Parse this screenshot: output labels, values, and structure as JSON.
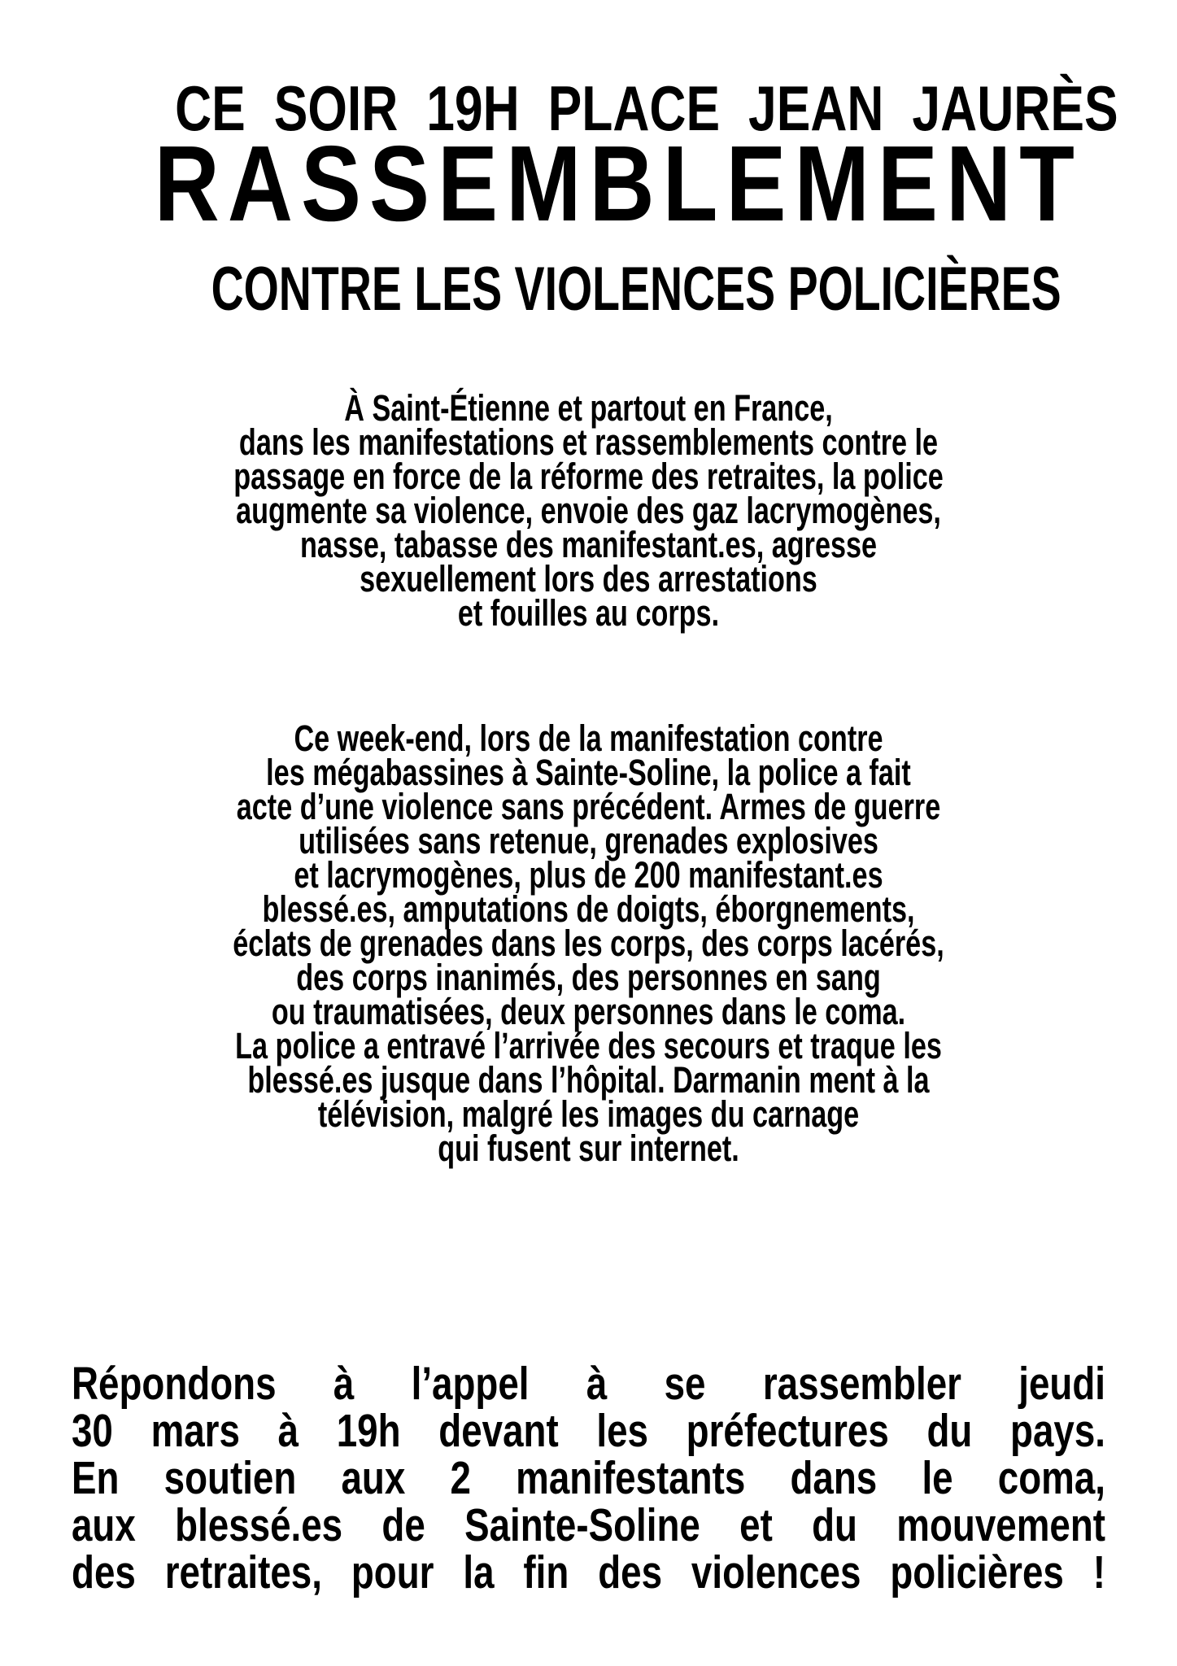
{
  "header": {
    "line1": "CE SOIR 19H PLACE JEAN JAURÈS",
    "line2": "RASSEMBLEMENT",
    "line3": "CONTRE LES VIOLENCES POLICIÈRES"
  },
  "paragraph1": [
    "À Saint-Étienne et partout en France,",
    "dans les manifestations et rassemblements contre le",
    "passage en force de la réforme des retraites, la police",
    "augmente sa violence, envoie des gaz lacrymogènes,",
    "nasse, tabasse des manifestant.es, agresse",
    "sexuellement lors des arrestations",
    "et fouilles au corps."
  ],
  "paragraph2": [
    "Ce week-end, lors de la manifestation contre",
    "les mégabassines à Sainte-Soline, la police a fait",
    "acte d’une violence sans précédent. Armes de guerre",
    "utilisées sans retenue, grenades explosives",
    "et lacrymogènes, plus de 200 manifestant.es",
    "blessé.es, amputations de doigts, éborgnements,",
    "éclats de grenades dans les corps, des corps lacérés,",
    "des corps inanimés, des personnes en sang",
    "ou traumatisées, deux personnes dans le coma.",
    "La police a entravé l’arrivée des secours et traque les",
    "blessé.es jusque dans l’hôpital. Darmanin ment à la",
    "télévision, malgré les images du carnage",
    "qui fusent sur internet."
  ],
  "call_to_action": [
    "Répondons à l’appel à se rassembler jeudi",
    "30 mars à 19h devant les préfectures du pays.",
    "En soutien aux 2 manifestants dans le coma,",
    "aux blessé.es de Sainte-Soline et du mouvement",
    "des retraites, pour la fin des violences policières !"
  ]
}
